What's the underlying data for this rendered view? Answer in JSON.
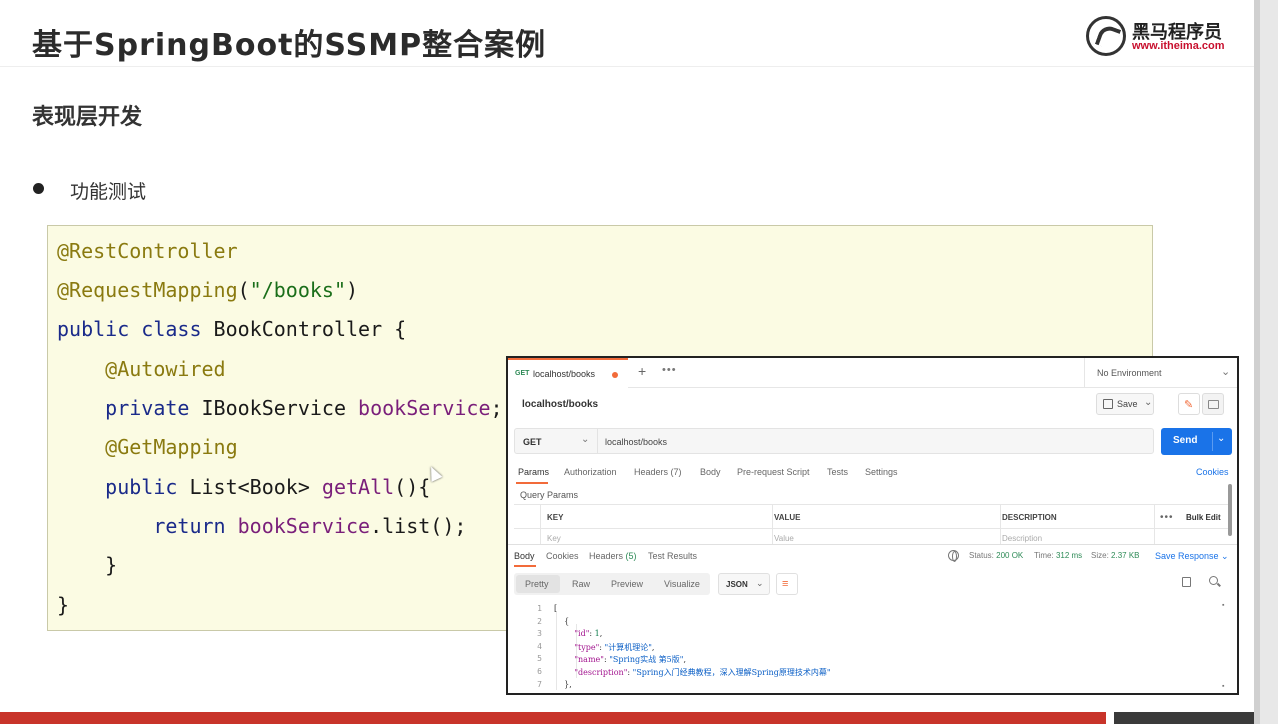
{
  "slide": {
    "title": "基于SpringBoot的SSMP整合案例",
    "section": "表现层开发",
    "bullet": "功能测试"
  },
  "logo": {
    "name_cn": "黑马程序员",
    "url": "www.itheima.com"
  },
  "code": {
    "lines": [
      {
        "parts": [
          {
            "t": "@RestController",
            "c": "ann"
          }
        ]
      },
      {
        "parts": [
          {
            "t": "@RequestMapping",
            "c": "ann"
          },
          {
            "t": "(",
            "c": "plain"
          },
          {
            "t": "\"/books\"",
            "c": "str"
          },
          {
            "t": ")",
            "c": "plain"
          }
        ]
      },
      {
        "parts": [
          {
            "t": "public class ",
            "c": "kw"
          },
          {
            "t": "BookController {",
            "c": "plain"
          }
        ]
      },
      {
        "parts": [
          {
            "t": "    ",
            "c": "plain"
          },
          {
            "t": "@Autowired",
            "c": "ann"
          }
        ]
      },
      {
        "parts": [
          {
            "t": "    ",
            "c": "plain"
          },
          {
            "t": "private ",
            "c": "kw"
          },
          {
            "t": "IBookService ",
            "c": "plain"
          },
          {
            "t": "bookService",
            "c": "fld"
          },
          {
            "t": ";",
            "c": "plain"
          }
        ]
      },
      {
        "parts": [
          {
            "t": "    ",
            "c": "plain"
          },
          {
            "t": "@GetMapping",
            "c": "ann"
          }
        ]
      },
      {
        "parts": [
          {
            "t": "    ",
            "c": "plain"
          },
          {
            "t": "public ",
            "c": "kw"
          },
          {
            "t": "List<Book> ",
            "c": "plain"
          },
          {
            "t": "getAll",
            "c": "fld"
          },
          {
            "t": "(){",
            "c": "plain"
          }
        ]
      },
      {
        "parts": [
          {
            "t": "        ",
            "c": "plain"
          },
          {
            "t": "return ",
            "c": "kw"
          },
          {
            "t": "bookService",
            "c": "fld"
          },
          {
            "t": ".list();",
            "c": "plain"
          }
        ]
      },
      {
        "parts": [
          {
            "t": "    }",
            "c": "plain"
          }
        ]
      },
      {
        "parts": [
          {
            "t": "}",
            "c": "plain"
          }
        ]
      }
    ]
  },
  "postman": {
    "tab": {
      "method": "GET",
      "name": "localhost/books"
    },
    "environment": "No Environment",
    "request_name": "localhost/books",
    "save_label": "Save",
    "method": "GET",
    "url": "localhost/books",
    "send_label": "Send",
    "request_tabs": [
      "Params",
      "Authorization",
      "Headers (7)",
      "Body",
      "Pre-request Script",
      "Tests",
      "Settings"
    ],
    "cookies_label": "Cookies",
    "query_params_title": "Query Params",
    "table": {
      "headers": [
        "KEY",
        "VALUE",
        "DESCRIPTION"
      ],
      "placeholders": [
        "Key",
        "Value",
        "Description"
      ],
      "bulk_edit": "Bulk Edit"
    },
    "response_tabs": {
      "body": "Body",
      "cookies": "Cookies",
      "headers": "Headers",
      "headers_count": "(5)",
      "tests": "Test Results"
    },
    "status": {
      "label": "Status:",
      "value": "200 OK",
      "time_label": "Time:",
      "time": "312 ms",
      "size_label": "Size:",
      "size": "2.37 KB"
    },
    "save_response": "Save Response",
    "view_tabs": [
      "Pretty",
      "Raw",
      "Preview",
      "Visualize"
    ],
    "format": "JSON",
    "json_lines": [
      {
        "n": "1",
        "parts": [
          {
            "t": "[",
            "c": "plain"
          }
        ]
      },
      {
        "n": "2",
        "parts": [
          {
            "t": "    {",
            "c": "plain"
          }
        ]
      },
      {
        "n": "3",
        "parts": [
          {
            "t": "        ",
            "c": "plain"
          },
          {
            "t": "\"id\"",
            "c": "key"
          },
          {
            "t": ": ",
            "c": "plain"
          },
          {
            "t": "1",
            "c": "num"
          },
          {
            "t": ",",
            "c": "plain"
          }
        ]
      },
      {
        "n": "4",
        "parts": [
          {
            "t": "        ",
            "c": "plain"
          },
          {
            "t": "\"type\"",
            "c": "key"
          },
          {
            "t": ": ",
            "c": "plain"
          },
          {
            "t": "\"计算机理论\"",
            "c": "str"
          },
          {
            "t": ",",
            "c": "plain"
          }
        ]
      },
      {
        "n": "5",
        "parts": [
          {
            "t": "        ",
            "c": "plain"
          },
          {
            "t": "\"name\"",
            "c": "key"
          },
          {
            "t": ": ",
            "c": "plain"
          },
          {
            "t": "\"Spring实战 第5版\"",
            "c": "str"
          },
          {
            "t": ",",
            "c": "plain"
          }
        ]
      },
      {
        "n": "6",
        "parts": [
          {
            "t": "        ",
            "c": "plain"
          },
          {
            "t": "\"description\"",
            "c": "key"
          },
          {
            "t": ": ",
            "c": "plain"
          },
          {
            "t": "\"Spring入门经典教程，深入理解Spring原理技术内幕\"",
            "c": "str"
          }
        ]
      },
      {
        "n": "7",
        "parts": [
          {
            "t": "    },",
            "c": "plain"
          }
        ]
      }
    ]
  },
  "colors": {
    "accent_orange": "#f26b3a",
    "send_blue": "#1a73e8",
    "status_green": "#2e8b57",
    "footer_red": "#c8342a"
  }
}
